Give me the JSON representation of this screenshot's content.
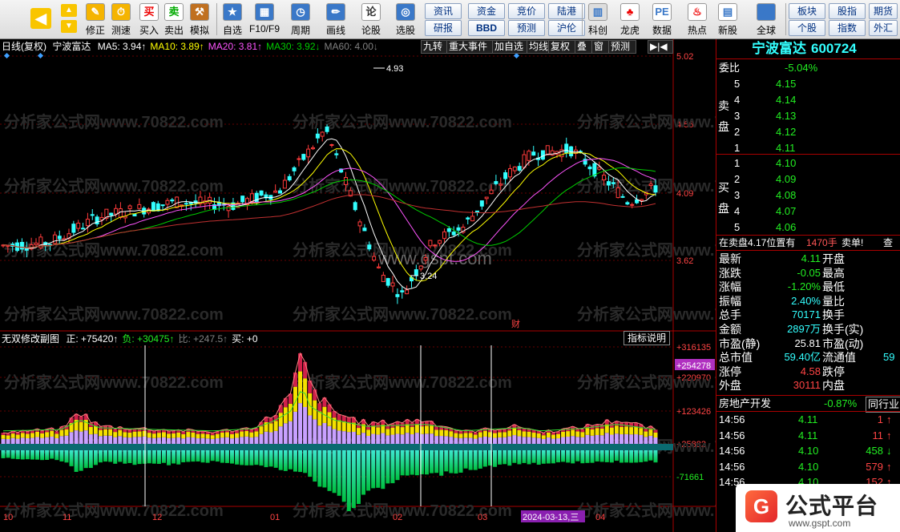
{
  "toolbar": {
    "left_buttons": [
      {
        "label": "修正",
        "icon": "revise-icon"
      },
      {
        "label": "测速",
        "icon": "speed-clock-icon"
      },
      {
        "label": "买入",
        "icon": "buy-icon",
        "glyph": "买"
      },
      {
        "label": "卖出",
        "icon": "sell-icon",
        "glyph": "卖"
      },
      {
        "label": "模拟",
        "icon": "hammer-icon"
      },
      {
        "label": "自选",
        "icon": "star-folder-icon"
      },
      {
        "label": "F10/F9",
        "icon": "f10-icon"
      },
      {
        "label": "周期",
        "icon": "period-clock-icon"
      },
      {
        "label": "画线",
        "icon": "pencil-icon"
      },
      {
        "label": "论股",
        "icon": "discuss-icon",
        "glyph": "论"
      },
      {
        "label": "选股",
        "icon": "select-stock-icon"
      }
    ],
    "grid_buttons": [
      [
        "资讯",
        "资金",
        "竞价",
        "陆港"
      ],
      [
        "研报",
        "BBD",
        "预测",
        "沪伦"
      ]
    ],
    "right_buttons": [
      {
        "label": "科创",
        "icon": "kechuang-icon"
      },
      {
        "label": "龙虎",
        "icon": "dragon-tiger-icon"
      },
      {
        "label": "数据",
        "icon": "pe-data-icon",
        "glyph": "PE"
      },
      {
        "label": "热点",
        "icon": "hot-icon"
      },
      {
        "label": "新股",
        "icon": "new-stock-icon"
      },
      {
        "label": "全球",
        "icon": "globe-icon"
      }
    ],
    "far_right_grid": [
      [
        "板块",
        "股指",
        "期货"
      ],
      [
        "个股",
        "指数",
        "外汇"
      ]
    ]
  },
  "main_header": {
    "period": "日线(复权)",
    "name": "宁波富达",
    "ma": [
      {
        "label": "MA5: 3.94↑",
        "color": "#ffffff"
      },
      {
        "label": "MA10: 3.89↑",
        "color": "#ffff00"
      },
      {
        "label": "MA20: 3.81↑",
        "color": "#ff55ff"
      },
      {
        "label": "MA30: 3.92↓",
        "color": "#00cc00"
      },
      {
        "label": "MA60: 4.00↓",
        "color": "#808080"
      }
    ],
    "menu": [
      "九转",
      "重大事件",
      "加自选",
      "均线",
      "复权",
      "叠",
      "窗",
      "预测"
    ]
  },
  "price_axis": [
    "5.02",
    "4.56",
    "4.09",
    "3.62"
  ],
  "annotations": {
    "high": "4.93",
    "low": "3.24",
    "cai": "财"
  },
  "sub_header": {
    "name": "无双修改副图",
    "values": [
      {
        "label": "正: +75420↑",
        "color": "#ffffff"
      },
      {
        "label": "负: +30475↑",
        "color": "#22ee22"
      },
      {
        "label": "比: +247.5↑",
        "color": "#808080"
      },
      {
        "label": "买: +0",
        "color": "#ffffff"
      }
    ],
    "button": "指标说明"
  },
  "sub_axis": [
    "+316135",
    "+254278",
    "+220970",
    "+123426",
    "+25882",
    "-71661"
  ],
  "date_axis": [
    "10",
    "11",
    "12",
    "01",
    "02",
    "03",
    "2024-03-13,三",
    "04"
  ],
  "watermarks": {
    "site": "分析家公式网www.70822.com",
    "gspt": "www.gspt.com"
  },
  "quote": {
    "title": "宁波富达",
    "code": "600724",
    "weibi_label": "委比",
    "weibi": "-5.04%",
    "sell_label": "卖盘",
    "buy_label": "买盘",
    "asks": [
      {
        "lvl": "5",
        "price": "4.15"
      },
      {
        "lvl": "4",
        "price": "4.14"
      },
      {
        "lvl": "3",
        "price": "4.13"
      },
      {
        "lvl": "2",
        "price": "4.12"
      },
      {
        "lvl": "1",
        "price": "4.11"
      }
    ],
    "bids": [
      {
        "lvl": "1",
        "price": "4.10"
      },
      {
        "lvl": "2",
        "price": "4.09"
      },
      {
        "lvl": "3",
        "price": "4.08"
      },
      {
        "lvl": "4",
        "price": "4.07"
      },
      {
        "lvl": "5",
        "price": "4.06"
      }
    ],
    "position_note": "在卖盘4.17位置有",
    "position_qty": "1470手",
    "position_tag": "卖单!",
    "position_more": "查",
    "stats": [
      {
        "k1": "最新",
        "v1": "4.11",
        "c1": "#22ee22",
        "k2": "开盘",
        "v2": "",
        "c2": "#fff"
      },
      {
        "k1": "涨跌",
        "v1": "-0.05",
        "c1": "#22ee22",
        "k2": "最高",
        "v2": "",
        "c2": "#fff"
      },
      {
        "k1": "涨幅",
        "v1": "-1.20%",
        "c1": "#22ee22",
        "k2": "最低",
        "v2": "",
        "c2": "#fff"
      },
      {
        "k1": "振幅",
        "v1": "2.40%",
        "c1": "#33ffff",
        "k2": "量比",
        "v2": "",
        "c2": "#fff"
      },
      {
        "k1": "总手",
        "v1": "70171",
        "c1": "#33ffff",
        "k2": "换手",
        "v2": "",
        "c2": "#fff"
      },
      {
        "k1": "金额",
        "v1": "2897万",
        "c1": "#33ffff",
        "k2": "换手(实)",
        "v2": "",
        "c2": "#fff"
      },
      {
        "k1": "市盈(静)",
        "v1": "25.81",
        "c1": "#ffffff",
        "k2": "市盈(动)",
        "v2": "",
        "c2": "#fff"
      },
      {
        "k1": "总市值",
        "v1": "59.40亿",
        "c1": "#33ffff",
        "k2": "流通值",
        "v2": "59",
        "c2": "#33ffff"
      },
      {
        "k1": "涨停",
        "v1": "4.58",
        "c1": "#ff4444",
        "k2": "跌停",
        "v2": "",
        "c2": "#fff"
      },
      {
        "k1": "外盘",
        "v1": "30111",
        "c1": "#ff4444",
        "k2": "内盘",
        "v2": "",
        "c2": "#fff"
      }
    ],
    "sector": "房地产开发",
    "sector_change": "-0.87%",
    "sector_btn": "同行业",
    "ticks": [
      {
        "time": "14:56",
        "price": "4.11",
        "vol": "1",
        "dir": "↑",
        "color": "#ff4444"
      },
      {
        "time": "14:56",
        "price": "4.11",
        "vol": "11",
        "dir": "↑",
        "color": "#ff4444"
      },
      {
        "time": "14:56",
        "price": "4.10",
        "vol": "458",
        "dir": "↓",
        "color": "#22ee22"
      },
      {
        "time": "14:56",
        "price": "4.10",
        "vol": "579",
        "dir": "↑",
        "color": "#ff4444"
      },
      {
        "time": "14:56",
        "price": "4.10",
        "vol": "152",
        "dir": "↑",
        "color": "#ff4444"
      }
    ]
  },
  "badge": {
    "text": "公式平台",
    "url": "www.gspt.com"
  }
}
